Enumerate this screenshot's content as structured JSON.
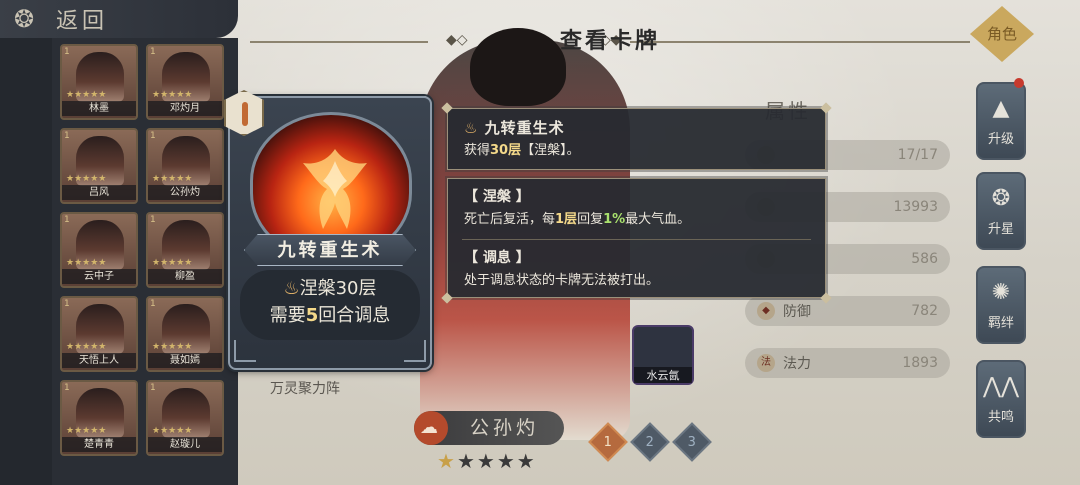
{
  "back": {
    "label": "返回",
    "icon": "back-swirl-icon"
  },
  "title": "查看卡牌",
  "roster": [
    {
      "name": "林墨",
      "level": "1"
    },
    {
      "name": "邓灼月",
      "level": "1"
    },
    {
      "name": "吕风",
      "level": "1"
    },
    {
      "name": "公孙灼",
      "level": "1"
    },
    {
      "name": "云中子",
      "level": "1"
    },
    {
      "name": "柳盈",
      "level": "1"
    },
    {
      "name": "天悟上人",
      "level": "1"
    },
    {
      "name": "聂如嫣",
      "level": "1"
    },
    {
      "name": "楚青青",
      "level": "1"
    },
    {
      "name": "赵璇儿",
      "level": "1"
    }
  ],
  "card": {
    "name": "九转重生术",
    "effect_prefix": "涅槃",
    "effect_value": "30层",
    "cost_prefix": "需要",
    "cost_value": "5",
    "cost_suffix": "回合调息"
  },
  "tooltip_skill": {
    "title": "九转重生术",
    "desc_prefix": "获得",
    "desc_value": "30层",
    "desc_suffix": "【涅槃】。"
  },
  "tooltip_terms": [
    {
      "title": "【 涅槃 】",
      "desc_a": "死亡后复活，每",
      "desc_b": "1层",
      "desc_c": "回复",
      "desc_d": "1%",
      "desc_e": "最大气血。"
    },
    {
      "title": "【 调息 】",
      "desc": "处于调息状态的卡牌无法被打出。"
    }
  ],
  "stats": {
    "header": "属性",
    "rows": [
      {
        "label": "",
        "value": "17/17"
      },
      {
        "label": "",
        "value": "13993"
      },
      {
        "label": "",
        "value": "586"
      },
      {
        "label": "防御",
        "value": "782"
      },
      {
        "label": "法力",
        "value": "1893"
      }
    ]
  },
  "ghost_skill_name": "水云氤",
  "ghost_card_label": "万灵聚力阵",
  "hero": {
    "name": "公孙灼",
    "stars_filled": 1,
    "stars_total": 5
  },
  "tiers": [
    "1",
    "2",
    "3"
  ],
  "side_menu": {
    "role": "角色",
    "items": [
      "升级",
      "升星",
      "羁绊",
      "共鸣"
    ]
  },
  "colors": {
    "highlight": "#f4d98a",
    "percent": "#a9e06d",
    "accent_fire": "#ff6a1a"
  }
}
